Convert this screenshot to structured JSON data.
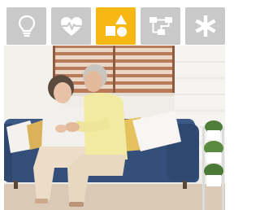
{
  "tabs": [
    {
      "icon": "lightbulb-icon",
      "selected": false
    },
    {
      "icon": "heart-pulse-icon",
      "selected": false
    },
    {
      "icon": "shapes-icon",
      "selected": true
    },
    {
      "icon": "flowchart-icon",
      "selected": false
    },
    {
      "icon": "asterisk-icon",
      "selected": false
    }
  ],
  "colors": {
    "tab_default": "#c9c9c9",
    "tab_selected": "#f7b814",
    "icon": "#ffffff"
  },
  "photo": {
    "subject": "elderly-couple-on-sofa"
  }
}
